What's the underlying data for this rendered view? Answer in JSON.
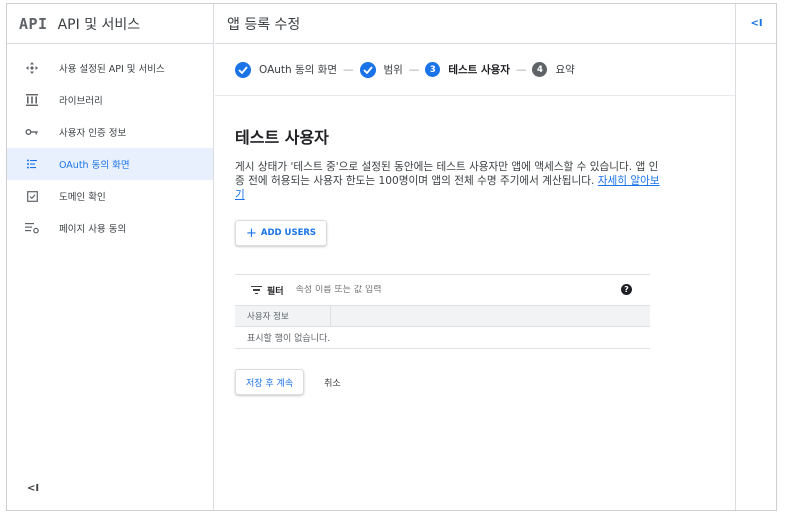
{
  "colors": {
    "accent": "#1a73e8",
    "active_bg": "#e8f0fe",
    "border": "#dadce0"
  },
  "sidebar": {
    "logo": "API",
    "title": "API 및 서비스",
    "items": [
      {
        "label": "사용 설정된 API 및 서비스",
        "icon": "api-services-icon"
      },
      {
        "label": "라이브러리",
        "icon": "library-icon"
      },
      {
        "label": "사용자 인증 정보",
        "icon": "key-icon"
      },
      {
        "label": "OAuth 동의 화면",
        "icon": "oauth-consent-icon",
        "active": true
      },
      {
        "label": "도메인 확인",
        "icon": "domain-verify-icon"
      },
      {
        "label": "페이지 사용 동의",
        "icon": "page-usage-icon"
      }
    ],
    "collapse_label": "<I"
  },
  "header": {
    "title": "앱 등록 수정"
  },
  "stepper": {
    "steps": [
      {
        "label": "OAuth 동의 화면",
        "state": "done"
      },
      {
        "label": "범위",
        "state": "done"
      },
      {
        "num": "3",
        "label": "테스트 사용자",
        "state": "current"
      },
      {
        "num": "4",
        "label": "요약",
        "state": "pending"
      }
    ],
    "separator": "—"
  },
  "content": {
    "title": "테스트 사용자",
    "description": "게시 상태가 '테스트 중'으로 설정된 동안에는 테스트 사용자만 앱에 액세스할 수 있습니다. 앱 인증 전에 허용되는 사용자 한도는 100명이며 앱의 전체 수명 주기에서 계산됩니다.",
    "learn_more": "자세히 알아보기",
    "add_users_label": "ADD USERS",
    "add_users_plus": "+"
  },
  "table": {
    "filter_label": "필터",
    "filter_placeholder": "속성 이름 또는 값 입력",
    "help": "?",
    "column_header": "사용자 정보",
    "empty_text": "표시할 행이 없습니다."
  },
  "actions": {
    "save_label": "저장 후 계속",
    "cancel_label": "취소"
  },
  "right_panel": {
    "toggle_label": "<I"
  }
}
